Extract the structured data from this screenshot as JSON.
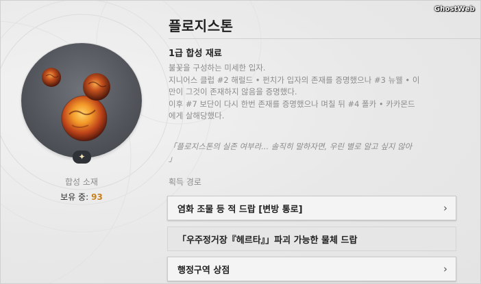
{
  "watermark": "GhostWeb",
  "item": {
    "category": "합성 소재",
    "owned_label": "보유 중:",
    "owned_count": "93",
    "badge_icon": "sparkle-icon",
    "rarity_symbol": "✦"
  },
  "detail": {
    "title": "플로지스톤",
    "subtitle": "1급 합성 재료",
    "description_lines": [
      "불꽃을 구성하는 미세한 입자.",
      "지니어스 클럽 #2 해럴드 • 펀치가 입자의 존재를 증명했으나 #3 뉴웰 • 이",
      "만이 그것이 존재하지 않음을 증명했다.",
      "이후 #7 보단이 다시 한번 존재를 증명했으나 며칠 뒤 #4 폴카 • 카카몬드",
      "에게 살해당했다."
    ],
    "quote_lines": [
      "「플로지스톤의 실존 여부라... 솔직히 말하자면, 우린 별로 알고 싶지 않아",
      "」"
    ],
    "acquisition_label": "획득 경로",
    "routes": [
      {
        "label": "염화 조물 등 적 드랍 [변방 통로]",
        "chevron": "›",
        "enabled": true
      },
      {
        "label": "「우주정거장『헤르타』」파괴 가능한 물체 드랍",
        "chevron": "",
        "enabled": false
      },
      {
        "label": "행정구역 상점",
        "chevron": "›",
        "enabled": true
      }
    ]
  },
  "colors": {
    "accent_count": "#c7821f",
    "disc": "#53565c",
    "badge": "#2f3237"
  }
}
